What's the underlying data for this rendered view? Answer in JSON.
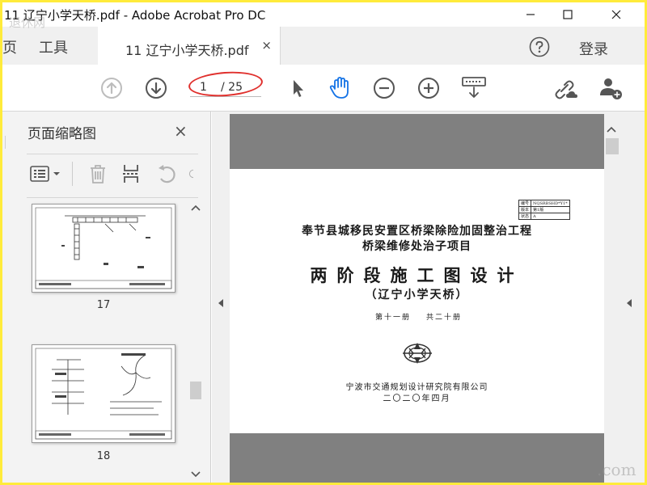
{
  "window": {
    "title": "11 辽宁小学天桥.pdf - Adobe Acrobat Pro DC",
    "minimize_icon": "minimize-icon",
    "maximize_icon": "maximize-icon",
    "close_icon": "close-icon"
  },
  "tabs": {
    "home_partial": "页",
    "tools": "工具",
    "document": "11 辽宁小学天桥.pdf",
    "close_glyph": "×",
    "login": "登录",
    "help_icon": "help-icon"
  },
  "toolbar": {
    "page_current": "1",
    "page_total": "/ 25",
    "icons": [
      "page-up-icon",
      "page-down-icon",
      "select-arrow-icon",
      "hand-icon",
      "zoom-out-icon",
      "zoom-in-icon",
      "keyboard-scroll-icon",
      "share-link-icon",
      "add-user-icon"
    ],
    "accent": "#1473e6",
    "annotation_color": "#e0302d"
  },
  "panel": {
    "title": "页面缩略图",
    "close_glyph": "×",
    "thumbnails": [
      {
        "page": "17"
      },
      {
        "page": "18"
      }
    ]
  },
  "document": {
    "project_line1": "奉节县城移民安置区桥梁除险加固整治工程",
    "project_line2": "桥梁维修处治子项目",
    "main_title": "两阶段施工图设计",
    "subtitle": "（辽宁小学天桥）",
    "volume_left": "第十一册",
    "volume_right": "共二十册",
    "organization": "宁波市交通规划设计研究院有限公司",
    "date": "二〇二〇年四月",
    "info_table": [
      [
        "编号",
        "NQSRBSHD*Y1*"
      ],
      [
        "版本",
        "第1版"
      ],
      [
        "状态",
        "A"
      ]
    ]
  },
  "watermark": {
    "top_left": "退休网",
    "bottom_right": ".com"
  }
}
